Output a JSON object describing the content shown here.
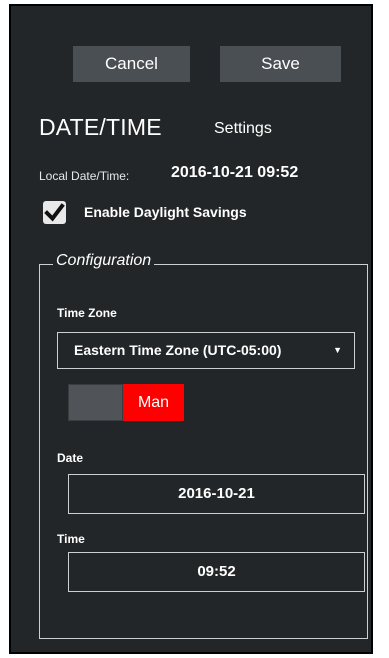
{
  "toolbar": {
    "cancel_label": "Cancel",
    "save_label": "Save"
  },
  "header": {
    "title": "DATE/TIME",
    "subtitle": "Settings"
  },
  "local_datetime": {
    "label": "Local Date/Time:",
    "value": "2016-10-21 09:52"
  },
  "daylight_savings": {
    "label": "Enable Daylight Savings",
    "checked": true
  },
  "configuration": {
    "legend": "Configuration",
    "timezone": {
      "label": "Time Zone",
      "value": "Eastern Time Zone (UTC-05:00)",
      "arrow": "▼"
    },
    "mode_toggle": {
      "state": "Man",
      "on_color": "#ff0000"
    },
    "date": {
      "label": "Date",
      "value": "2016-10-21"
    },
    "time": {
      "label": "Time",
      "value": "09:52"
    }
  }
}
